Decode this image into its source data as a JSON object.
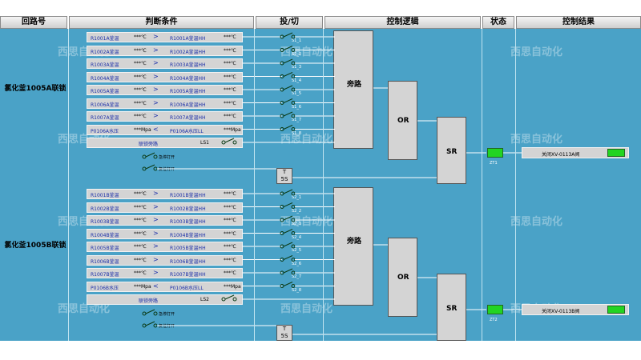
{
  "headers": [
    "回路号",
    "判断条件",
    "投/切",
    "控制逻辑",
    "状态",
    "控制结果"
  ],
  "watermark": "西思自动化",
  "groups": [
    {
      "title": "氯化釜1005A联锁",
      "conditions": [
        {
          "a": "R1001A釜温",
          "av": "***℃",
          "op": ">",
          "b": "R1001A釜温HH",
          "bv": "***℃",
          "sw": "S1_1"
        },
        {
          "a": "R1002A釜温",
          "av": "***℃",
          "op": ">",
          "b": "R1002A釜温HH",
          "bv": "***℃",
          "sw": "S1_2"
        },
        {
          "a": "R1003A釜温",
          "av": "***℃",
          "op": ">",
          "b": "R1003A釜温HH",
          "bv": "***℃",
          "sw": "S1_3"
        },
        {
          "a": "R1004A釜温",
          "av": "***℃",
          "op": ">",
          "b": "R1004A釜温HH",
          "bv": "***℃",
          "sw": "S1_4"
        },
        {
          "a": "R1005A釜温",
          "av": "***℃",
          "op": ">",
          "b": "R1005A釜温HH",
          "bv": "***℃",
          "sw": "S1_5"
        },
        {
          "a": "R1006A釜温",
          "av": "***℃",
          "op": ">",
          "b": "R1006A釜温HH",
          "bv": "***℃",
          "sw": "S1_6"
        },
        {
          "a": "R1007A釜温",
          "av": "***℃",
          "op": ">",
          "b": "R1007A釜温HH",
          "bv": "***℃",
          "sw": "S1_7"
        },
        {
          "a": "P0106A水压",
          "av": "***Mpa",
          "op": "<",
          "b": "P0106A水压LL",
          "bv": "***Mpa",
          "sw": "S1_8"
        }
      ],
      "bypass_label": "联锁旁路",
      "bypass_tag": "LS1",
      "manual_on": "急停打开",
      "manual_off": "复位打开",
      "bypass_block": "旁路",
      "or_block": "OR",
      "sr_block": "SR",
      "timer": {
        "label": "T",
        "value": "5S"
      },
      "status_tag": "ZT1",
      "result": "关闭XV-0113A阀"
    },
    {
      "title": "氯化釜1005B联锁",
      "conditions": [
        {
          "a": "R1001B釜温",
          "av": "***℃",
          "op": ">",
          "b": "R1001B釜温HH",
          "bv": "***℃",
          "sw": "S2_1"
        },
        {
          "a": "R1002B釜温",
          "av": "***℃",
          "op": ">",
          "b": "R1002B釜温HH",
          "bv": "***℃",
          "sw": "S2_2"
        },
        {
          "a": "R1003B釜温",
          "av": "***℃",
          "op": ">",
          "b": "R1003B釜温HH",
          "bv": "***℃",
          "sw": "S2_3"
        },
        {
          "a": "R1004B釜温",
          "av": "***℃",
          "op": ">",
          "b": "R1004B釜温HH",
          "bv": "***℃",
          "sw": "S2_4"
        },
        {
          "a": "R1005B釜温",
          "av": "***℃",
          "op": ">",
          "b": "R1005B釜温HH",
          "bv": "***℃",
          "sw": "S2_5"
        },
        {
          "a": "R1006B釜温",
          "av": "***℃",
          "op": ">",
          "b": "R1006B釜温HH",
          "bv": "***℃",
          "sw": "S2_6"
        },
        {
          "a": "R1007B釜温",
          "av": "***℃",
          "op": ">",
          "b": "R1007B釜温HH",
          "bv": "***℃",
          "sw": "S2_7"
        },
        {
          "a": "P0106B水压",
          "av": "***Mpa",
          "op": "<",
          "b": "P0106B水压LL",
          "bv": "***Mpa",
          "sw": "S2_8"
        }
      ],
      "bypass_label": "联锁旁路",
      "bypass_tag": "LS2",
      "manual_on": "急停打开",
      "manual_off": "复位打开",
      "bypass_block": "旁路",
      "or_block": "OR",
      "sr_block": "SR",
      "timer": {
        "label": "T",
        "value": "5S"
      },
      "status_tag": "ZT2",
      "result": "关闭XV-0113B阀"
    }
  ],
  "colors": {
    "panel": "#4aa2c7",
    "status_on": "#22d422",
    "block": "#d4d4d4"
  }
}
